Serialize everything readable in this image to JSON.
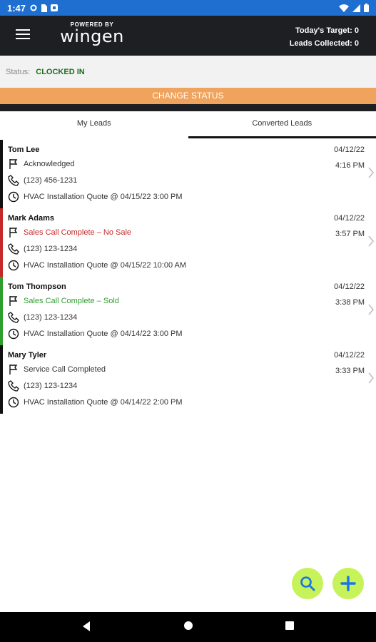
{
  "statusbar": {
    "time": "1:47"
  },
  "header": {
    "powered_by": "POWERED BY",
    "logo": "wingen",
    "target_line": "Today's Target: 0",
    "leads_line": "Leads Collected: 0"
  },
  "status": {
    "label": "Status:",
    "value": "CLOCKED IN",
    "button": "CHANGE STATUS"
  },
  "tabs": [
    {
      "label": "My Leads"
    },
    {
      "label": "Converted Leads"
    }
  ],
  "leads": [
    {
      "name": "Tom Lee",
      "status": "Acknowledged",
      "phone": "(123) 456-1231",
      "appointment": "HVAC Installation Quote @ 04/15/22 3:00 PM",
      "date": "04/12/22",
      "time": "4:16 PM",
      "bar_color": "#111111",
      "status_color": "#333333"
    },
    {
      "name": "Mark Adams",
      "status": "Sales Call Complete – No Sale",
      "phone": "(123) 123-1234",
      "appointment": "HVAC Installation Quote @ 04/15/22 10:00 AM",
      "date": "04/12/22",
      "time": "3:57 PM",
      "bar_color": "#c62828",
      "status_color": "#c62828"
    },
    {
      "name": "Tom Thompson",
      "status": "Sales Call Complete – Sold",
      "phone": "(123) 123-1234",
      "appointment": "HVAC Installation Quote @ 04/14/22 3:00 PM",
      "date": "04/12/22",
      "time": "3:38 PM",
      "bar_color": "#2e9e2e",
      "status_color": "#2e9e2e"
    },
    {
      "name": "Mary Tyler",
      "status": "Service Call Completed",
      "phone": "(123) 123-1234",
      "appointment": "HVAC Installation Quote @ 04/14/22 2:00 PM",
      "date": "04/12/22",
      "time": "3:33 PM",
      "bar_color": "#111111",
      "status_color": "#333333"
    }
  ],
  "icons": {
    "menu": "hamburger-icon",
    "flag": "flag-icon",
    "phone": "phone-icon",
    "clock": "clock-icon",
    "chevron": "chevron-right-icon",
    "search": "search-icon",
    "add": "plus-icon"
  },
  "colors": {
    "accent": "#efa35d",
    "appbar": "#1e1f23",
    "fab": "#c6f25a",
    "clocked_in": "#1b6e1b"
  }
}
